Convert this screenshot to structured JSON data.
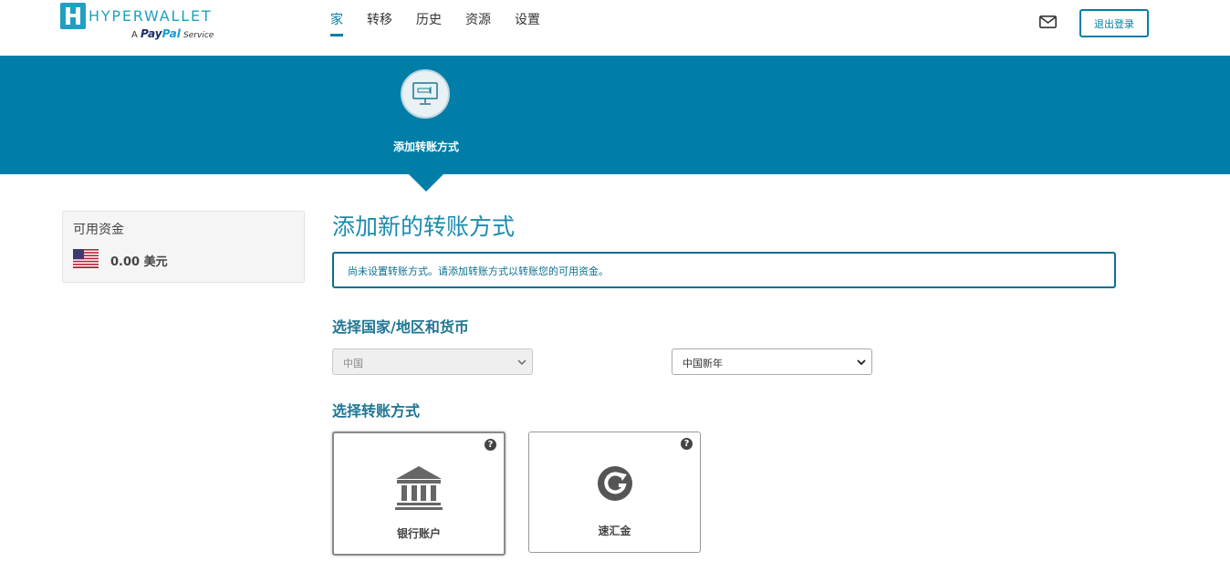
{
  "header": {
    "logo": {
      "word": "HYPERWALLET",
      "sub_a": "A",
      "sub_pay": "Pay",
      "sub_pal": "Pal",
      "sub_service": "Service"
    },
    "nav": [
      {
        "label": "家",
        "active": true
      },
      {
        "label": "转移",
        "active": false
      },
      {
        "label": "历史",
        "active": false
      },
      {
        "label": "资源",
        "active": false
      },
      {
        "label": "设置",
        "active": false
      }
    ],
    "logout_label": "退出登录"
  },
  "banner": {
    "step_label": "添加转账方式",
    "color": "#007ea7"
  },
  "funds": {
    "title": "可用资金",
    "amount": "0.00 美元"
  },
  "main": {
    "title": "添加新的转账方式",
    "alert": "尚未设置转账方式。请添加转账方式以转账您的可用资金。",
    "country_section": "选择国家/地区和货币",
    "country_value": "中国",
    "currency_value": "中国新年",
    "method_section": "选择转账方式",
    "methods": [
      {
        "label": "银行账户",
        "icon": "bank-icon",
        "selected": true
      },
      {
        "label": "速汇金",
        "icon": "moneygram-icon",
        "selected": false
      }
    ],
    "help_glyph": "?"
  }
}
